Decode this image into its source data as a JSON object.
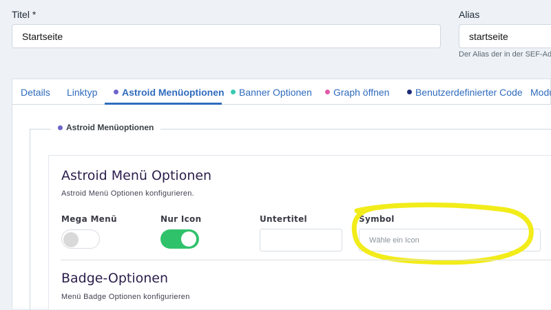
{
  "title_field": {
    "label": "Titel *",
    "value": "Startseite"
  },
  "alias_field": {
    "label": "Alias",
    "value": "startseite",
    "help": "Der Alias der in der SEF-Ad"
  },
  "tabs": [
    {
      "label": "Details",
      "dot": null
    },
    {
      "label": "Linktyp",
      "dot": null
    },
    {
      "label": "Astroid Menüoptionen",
      "dot": "#6c63c9",
      "active": true
    },
    {
      "label": "Banner Optionen",
      "dot": "#36c9b0"
    },
    {
      "label": "Graph öffnen",
      "dot": "#e05aa8"
    },
    {
      "label": "Benutzerdefinierter Code",
      "dot": "#1d2a7a"
    },
    {
      "label": "Modu",
      "dot": null
    }
  ],
  "fieldset_legend": "Astroid Menüoptionen",
  "section": {
    "title": "Astroid Menü Optionen",
    "description": "Astroid Menü Optionen konfigurieren."
  },
  "options": {
    "mega_menu": {
      "label": "Mega Menü",
      "state": "off"
    },
    "icon_only": {
      "label": "Nur Icon",
      "state": "on"
    },
    "subtitle": {
      "label": "Untertitel",
      "value": ""
    },
    "symbol": {
      "label": "Symbol",
      "placeholder": "Wähle ein Icon"
    }
  },
  "badge_section": {
    "title": "Badge-Optionen",
    "description": "Menü Badge Optionen konfigurieren"
  },
  "colors": {
    "accent": "#2f6bbd",
    "toggle_on": "#2fc26b",
    "highlight": "#f2ec1a"
  }
}
